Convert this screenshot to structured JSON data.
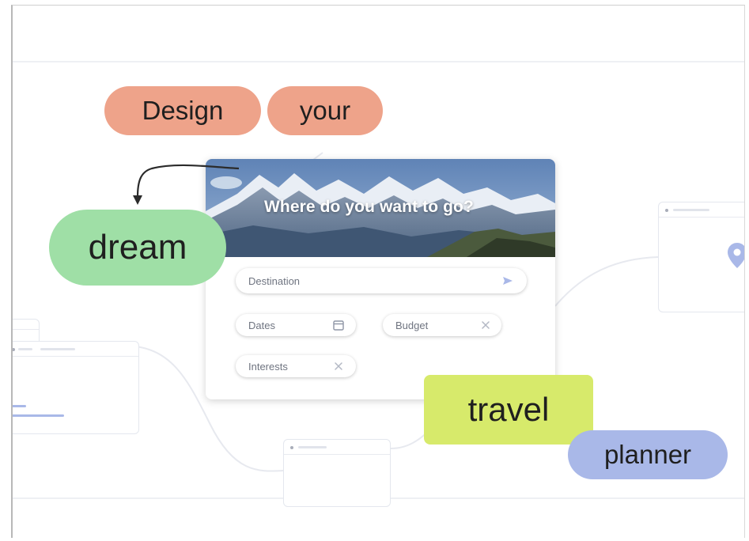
{
  "pills": {
    "design": "Design",
    "your": "your",
    "dream": "dream",
    "travel": "travel",
    "planner": "planner"
  },
  "card": {
    "hero_title": "Where do you want to go?",
    "destination": {
      "placeholder": "Destination",
      "icon": "send-icon"
    },
    "dates": {
      "placeholder": "Dates",
      "icon": "calendar-icon"
    },
    "budget": {
      "placeholder": "Budget",
      "icon": "close-icon"
    },
    "interests": {
      "placeholder": "Interests",
      "icon": "close-icon"
    }
  },
  "colors": {
    "pill_design": "#eea38a",
    "pill_dream": "#9fdfa6",
    "pill_travel": "#d7ea6b",
    "pill_planner": "#a9b8e8",
    "accent_location": "#a9b8e8"
  },
  "icons": [
    "arrow-curve-icon",
    "location-pin-icon",
    "send-icon",
    "calendar-icon",
    "close-icon"
  ]
}
